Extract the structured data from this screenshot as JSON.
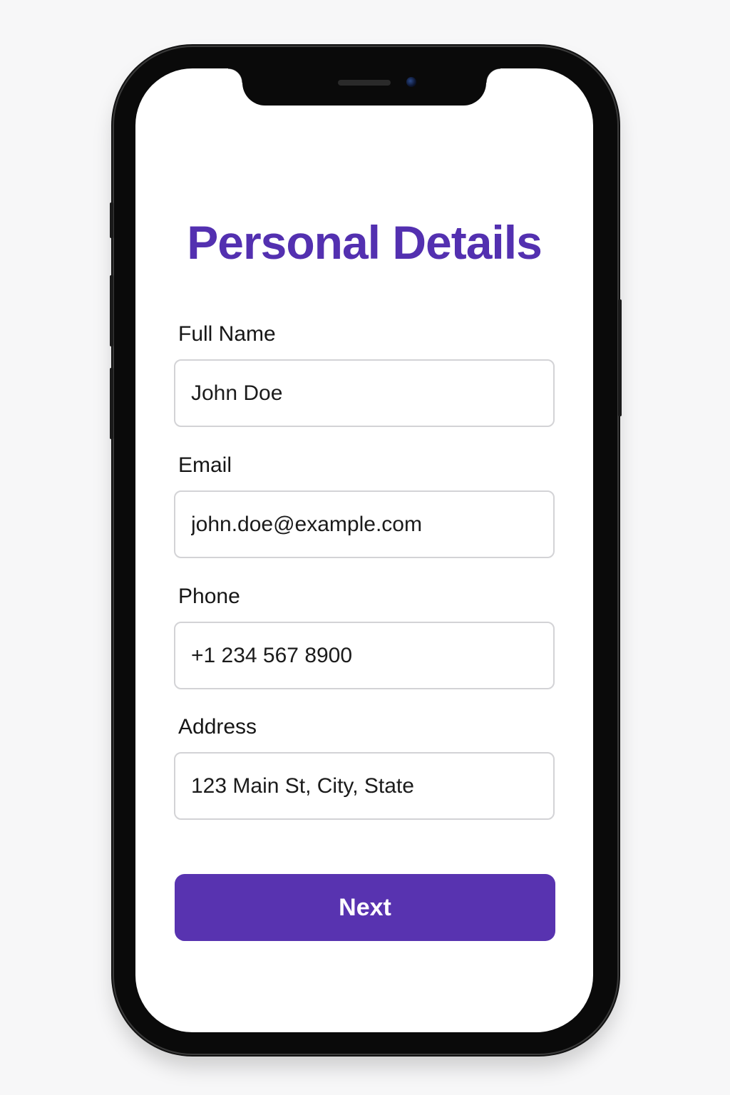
{
  "screen": {
    "title": "Personal Details"
  },
  "form": {
    "fields": [
      {
        "label": "Full Name",
        "value": "John Doe"
      },
      {
        "label": "Email",
        "value": "john.doe@example.com"
      },
      {
        "label": "Phone",
        "value": "+1 234 567 8900"
      },
      {
        "label": "Address",
        "value": "123 Main St, City, State"
      }
    ],
    "next_label": "Next"
  },
  "colors": {
    "accent": "#5833b0",
    "title": "#5330b0",
    "input_border": "#d3d3d6"
  }
}
